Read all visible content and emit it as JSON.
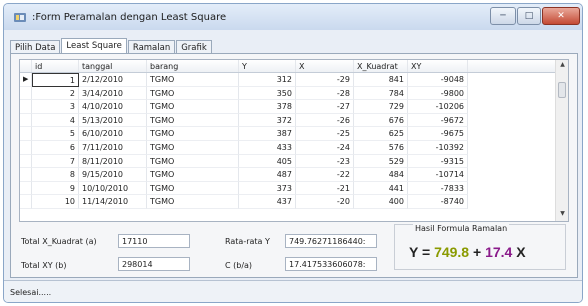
{
  "window": {
    "title": ":Form Peramalan dengan Least Square"
  },
  "tabs": [
    {
      "label": "Pilih Data"
    },
    {
      "label": "Least Square"
    },
    {
      "label": "Ramalan"
    },
    {
      "label": "Grafik"
    }
  ],
  "grid": {
    "columns": [
      "id",
      "tanggal",
      "barang",
      "Y",
      "X",
      "X_Kuadrat",
      "XY"
    ],
    "rows": [
      [
        "1",
        "2/12/2010",
        "TGMO",
        "312",
        "-29",
        "841",
        "-9048"
      ],
      [
        "2",
        "3/14/2010",
        "TGMO",
        "350",
        "-28",
        "784",
        "-9800"
      ],
      [
        "3",
        "4/10/2010",
        "TGMO",
        "378",
        "-27",
        "729",
        "-10206"
      ],
      [
        "4",
        "5/13/2010",
        "TGMO",
        "372",
        "-26",
        "676",
        "-9672"
      ],
      [
        "5",
        "6/10/2010",
        "TGMO",
        "387",
        "-25",
        "625",
        "-9675"
      ],
      [
        "6",
        "7/11/2010",
        "TGMO",
        "433",
        "-24",
        "576",
        "-10392"
      ],
      [
        "7",
        "8/11/2010",
        "TGMO",
        "405",
        "-23",
        "529",
        "-9315"
      ],
      [
        "8",
        "9/15/2010",
        "TGMO",
        "487",
        "-22",
        "484",
        "-10714"
      ],
      [
        "9",
        "10/10/2010",
        "TGMO",
        "373",
        "-21",
        "441",
        "-7833"
      ],
      [
        "10",
        "11/14/2010",
        "TGMO",
        "437",
        "-20",
        "400",
        "-8740"
      ]
    ]
  },
  "fields": {
    "total_xk_label": "Total X_Kuadrat (a)",
    "total_xk_value": "17110",
    "total_xy_label": "Total XY (b)",
    "total_xy_value": "298014",
    "rata_y_label": "Rata-rata Y",
    "rata_y_value": "749.76271186440:",
    "c_label": "C (b/a)",
    "c_value": "17.417533606078:"
  },
  "hasil": {
    "title": "Hasil Formula Ramalan",
    "y": "Y",
    "eq": "=",
    "a": "749.8",
    "plus": "+",
    "b": "17.4",
    "x": "X",
    "colors": {
      "a": "#8a9a00",
      "b": "#8a1a8a"
    }
  },
  "status": {
    "text": "Selesai....."
  }
}
